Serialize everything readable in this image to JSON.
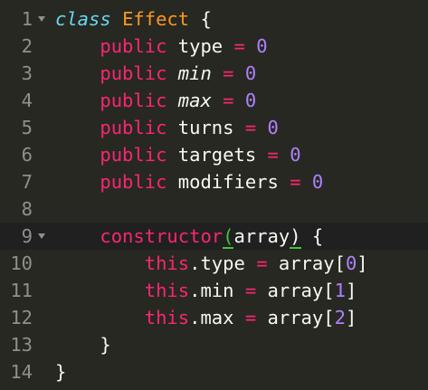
{
  "editor": {
    "lines": [
      {
        "n": "1",
        "t": [
          {
            "s": "class",
            "c": "kw-class"
          },
          {
            "s": " "
          },
          {
            "s": "Effect",
            "c": "cls-name"
          },
          {
            "s": " {"
          }
        ]
      },
      {
        "n": "2",
        "t": [
          {
            "s": "    "
          },
          {
            "s": "public",
            "c": "kw"
          },
          {
            "s": " type "
          },
          {
            "s": "=",
            "c": "kw"
          },
          {
            "s": " "
          },
          {
            "s": "0",
            "c": "num"
          }
        ]
      },
      {
        "n": "3",
        "t": [
          {
            "s": "    "
          },
          {
            "s": "public",
            "c": "kw"
          },
          {
            "s": " "
          },
          {
            "s": "min",
            "c": "italic"
          },
          {
            "s": " "
          },
          {
            "s": "=",
            "c": "kw"
          },
          {
            "s": " "
          },
          {
            "s": "0",
            "c": "num"
          }
        ]
      },
      {
        "n": "4",
        "t": [
          {
            "s": "    "
          },
          {
            "s": "public",
            "c": "kw"
          },
          {
            "s": " "
          },
          {
            "s": "max",
            "c": "italic"
          },
          {
            "s": " "
          },
          {
            "s": "=",
            "c": "kw"
          },
          {
            "s": " "
          },
          {
            "s": "0",
            "c": "num"
          }
        ]
      },
      {
        "n": "5",
        "t": [
          {
            "s": "    "
          },
          {
            "s": "public",
            "c": "kw"
          },
          {
            "s": " turns "
          },
          {
            "s": "=",
            "c": "kw"
          },
          {
            "s": " "
          },
          {
            "s": "0",
            "c": "num"
          }
        ]
      },
      {
        "n": "6",
        "t": [
          {
            "s": "    "
          },
          {
            "s": "public",
            "c": "kw"
          },
          {
            "s": " targets "
          },
          {
            "s": "=",
            "c": "kw"
          },
          {
            "s": " "
          },
          {
            "s": "0",
            "c": "num"
          }
        ]
      },
      {
        "n": "7",
        "t": [
          {
            "s": "    "
          },
          {
            "s": "public",
            "c": "kw"
          },
          {
            "s": " modifiers "
          },
          {
            "s": "=",
            "c": "kw"
          },
          {
            "s": " "
          },
          {
            "s": "0",
            "c": "num"
          }
        ]
      },
      {
        "n": "8",
        "t": []
      },
      {
        "n": "9",
        "t": [
          {
            "s": "    "
          },
          {
            "s": "constructor",
            "c": "kw"
          },
          {
            "s": "(",
            "c": "paren-match green"
          },
          {
            "s": "array"
          },
          {
            "s": ")",
            "c": "paren-match"
          },
          {
            "s": " {"
          }
        ]
      },
      {
        "n": "10",
        "t": [
          {
            "s": "        "
          },
          {
            "s": "this",
            "c": "kw"
          },
          {
            "s": ".type "
          },
          {
            "s": "=",
            "c": "kw"
          },
          {
            "s": " array["
          },
          {
            "s": "0",
            "c": "num"
          },
          {
            "s": "]"
          }
        ]
      },
      {
        "n": "11",
        "t": [
          {
            "s": "        "
          },
          {
            "s": "this",
            "c": "kw"
          },
          {
            "s": ".min "
          },
          {
            "s": "=",
            "c": "kw"
          },
          {
            "s": " array["
          },
          {
            "s": "1",
            "c": "num"
          },
          {
            "s": "]"
          }
        ]
      },
      {
        "n": "12",
        "t": [
          {
            "s": "        "
          },
          {
            "s": "this",
            "c": "kw"
          },
          {
            "s": ".max "
          },
          {
            "s": "=",
            "c": "kw"
          },
          {
            "s": " array["
          },
          {
            "s": "2",
            "c": "num"
          },
          {
            "s": "]"
          }
        ]
      },
      {
        "n": "13",
        "t": [
          {
            "s": "    }"
          }
        ]
      },
      {
        "n": "14",
        "t": [
          {
            "s": "}"
          }
        ]
      }
    ],
    "fold_lines": [
      "1",
      "9"
    ],
    "active_line": "9",
    "colors": {
      "background": "#272822",
      "gutter_text": "#8f908a",
      "keyword": "#f92672",
      "class_keyword": "#66d9ef",
      "class_name": "#fd971f",
      "number": "#ae81ff",
      "bracket_match": "#44c23a"
    }
  }
}
